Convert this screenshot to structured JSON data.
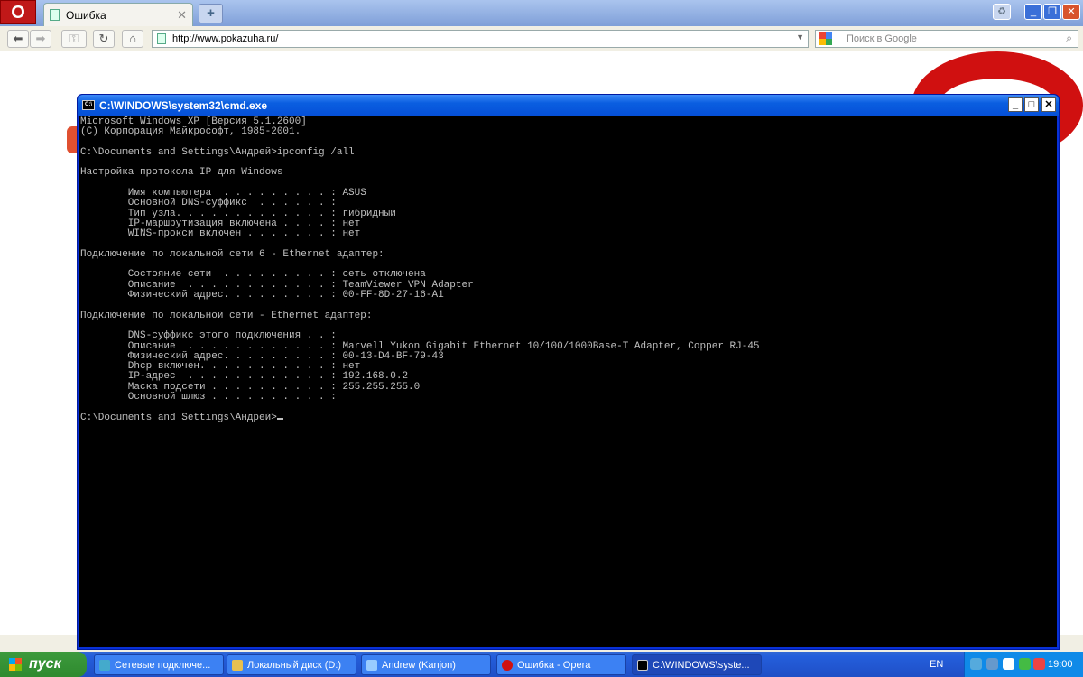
{
  "browser": {
    "tab_title": "Ошибка",
    "url": "http://www.pokazuha.ru/",
    "search_placeholder": "Поиск в Google"
  },
  "cmd": {
    "title": "C:\\WINDOWS\\system32\\cmd.exe",
    "lines": [
      "Microsoft Windows XP [Версия 5.1.2600]",
      "(С) Корпорация Майкрософт, 1985-2001.",
      "",
      "C:\\Documents and Settings\\Андрей>ipconfig /all",
      "",
      "Настройка протокола IP для Windows",
      "",
      "        Имя компьютера  . . . . . . . . . : ASUS",
      "        Основной DNS-суффикс  . . . . . . :",
      "        Тип узла. . . . . . . . . . . . . : гибридный",
      "        IP-маршрутизация включена . . . . : нет",
      "        WINS-прокси включен . . . . . . . : нет",
      "",
      "Подключение по локальной сети 6 - Ethernet адаптер:",
      "",
      "        Состояние сети  . . . . . . . . . : сеть отключена",
      "        Описание  . . . . . . . . . . . . : TeamViewer VPN Adapter",
      "        Физический адрес. . . . . . . . . : 00-FF-8D-27-16-A1",
      "",
      "Подключение по локальной сети - Ethernet адаптер:",
      "",
      "        DNS-суффикс этого подключения . . :",
      "        Описание  . . . . . . . . . . . . : Marvell Yukon Gigabit Ethernet 10/100/1000Base-T Adapter, Copper RJ-45",
      "        Физический адрес. . . . . . . . . : 00-13-D4-BF-79-43",
      "        Dhcp включен. . . . . . . . . . . : нет",
      "        IP-адрес  . . . . . . . . . . . . : 192.168.0.2",
      "        Маска подсети . . . . . . . . . . : 255.255.255.0",
      "        Основной шлюз . . . . . . . . . . :",
      ""
    ],
    "prompt": "C:\\Documents and Settings\\Андрей>"
  },
  "taskbar": {
    "start_label": "пуск",
    "items": [
      {
        "label": "Сетевые подключе..."
      },
      {
        "label": "Локальный диск (D:)"
      },
      {
        "label": "Andrew (Kanjon)"
      },
      {
        "label": "Ошибка - Opera"
      },
      {
        "label": "C:\\WINDOWS\\syste..."
      }
    ],
    "lang": "EN",
    "clock": "19:00"
  }
}
